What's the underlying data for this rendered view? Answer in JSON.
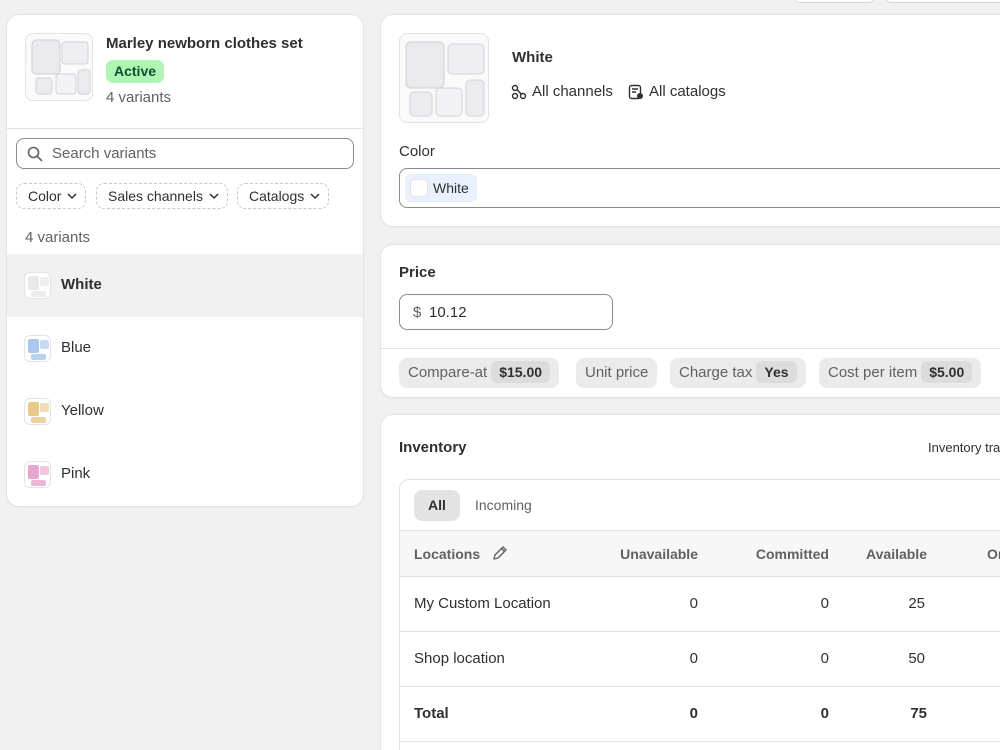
{
  "product": {
    "title": "Marley newborn clothes set",
    "status": "Active",
    "variant_count_label": "4 variants"
  },
  "search": {
    "placeholder": "Search variants"
  },
  "filters": [
    {
      "label": "Color"
    },
    {
      "label": "Sales channels"
    },
    {
      "label": "Catalogs"
    }
  ],
  "variants_count_label": "4 variants",
  "variants": [
    {
      "label": "White",
      "selected": true,
      "tint": "#e8e8e8"
    },
    {
      "label": "Blue",
      "selected": false,
      "tint": "#a9c8ec"
    },
    {
      "label": "Yellow",
      "selected": false,
      "tint": "#e8c98c"
    },
    {
      "label": "Pink",
      "selected": false,
      "tint": "#e6a6cf"
    }
  ],
  "variant_detail": {
    "title": "White",
    "channels_label": "All channels",
    "catalogs_label": "All catalogs",
    "color_label": "Color",
    "color_value": "White"
  },
  "pricing": {
    "label": "Price",
    "currency": "$",
    "price": "10.12",
    "compare_at_label": "Compare-at",
    "compare_at_value": "$15.00",
    "unit_price_label": "Unit price",
    "charge_tax_label": "Charge tax",
    "charge_tax_value": "Yes",
    "cost_label": "Cost per item",
    "cost_value": "$5.00"
  },
  "inventory": {
    "title": "Inventory",
    "tracking_label": "Inventory tra",
    "tabs": [
      "All",
      "Incoming"
    ],
    "columns": {
      "locations": "Locations",
      "unavailable": "Unavailable",
      "committed": "Committed",
      "available": "Available",
      "on_hand": "Or"
    },
    "rows": [
      {
        "location": "My Custom Location",
        "unavailable": "0",
        "committed": "0",
        "available": "25"
      },
      {
        "location": "Shop location",
        "unavailable": "0",
        "committed": "0",
        "available": "50"
      }
    ],
    "total": {
      "label": "Total",
      "unavailable": "0",
      "committed": "0",
      "available": "75"
    }
  },
  "colors": {
    "active_badge_bg": "#aff5b4",
    "active_badge_text": "#0c5132",
    "selected_row_bg": "#f1f1f1"
  }
}
